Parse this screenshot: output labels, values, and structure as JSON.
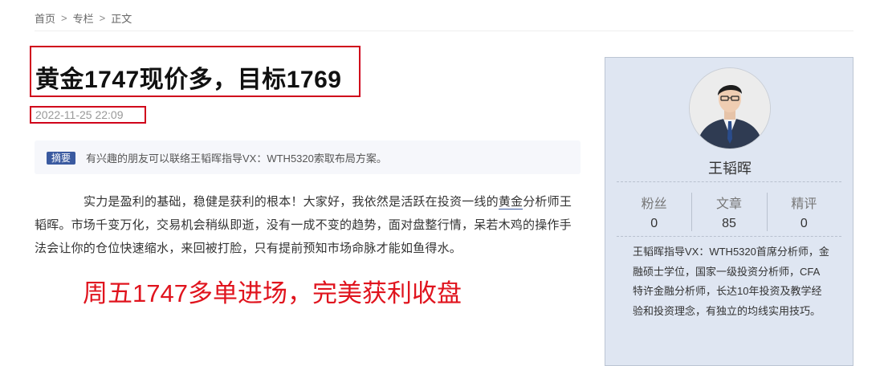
{
  "breadcrumb": {
    "items": [
      "首页",
      "专栏",
      "正文"
    ],
    "separator": ">"
  },
  "article": {
    "title": "黄金1747现价多，目标1769",
    "date": "2022-11-25 22:09",
    "summary_badge": "摘要",
    "summary": "有兴趣的朋友可以联络王韬晖指导VX：WTH5320索取布局方案。",
    "body_before": "实力是盈利的基础，稳健是获利的根本！大家好，我依然是活跃在投资一线的",
    "body_keyword": "黄金",
    "body_after": "分析师王韬晖。市场千变万化，交易机会稍纵即逝，没有一成不变的趋势，面对盘整行情，呆若木鸡的操作手法会让你的仓位快速缩水，来回被打脸，只有提前预知市场命脉才能如鱼得水。",
    "highlight": "周五1747多单进场，完美获利收盘"
  },
  "author": {
    "name": "王韬晖",
    "stats": [
      {
        "label": "粉丝",
        "value": "0"
      },
      {
        "label": "文章",
        "value": "85"
      },
      {
        "label": "精评",
        "value": "0"
      }
    ],
    "bio": "王韬晖指导VX：WTH5320首席分析师，金融硕士学位，国家一级投资分析师，CFA特许金融分析师，长达10年投资及教学经验和投资理念，有独立的均线实用技巧。"
  },
  "colors": {
    "annotation_box": "#d0021b",
    "highlight_text": "#e0141e",
    "badge": "#3a5aa0",
    "sidebar_bg": "#dfe6f2"
  }
}
